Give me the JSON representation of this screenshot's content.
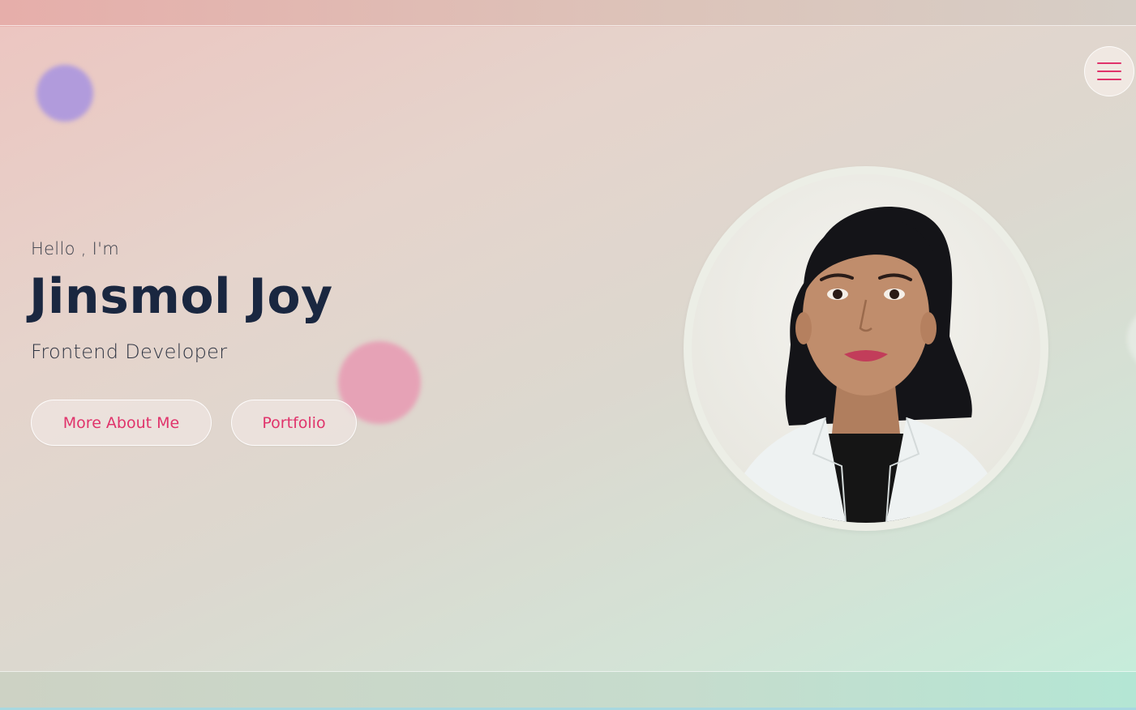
{
  "hero": {
    "greeting": "Hello , I'm",
    "name": "Jinsmol Joy",
    "role": "Frontend Developer",
    "buttons": {
      "about_label": "More About Me",
      "portfolio_label": "Portfolio"
    }
  },
  "nav": {
    "menu_icon": "hamburger-menu-icon"
  },
  "colors": {
    "accent": "#e0336b",
    "heading": "#1a2740",
    "blob_purple": "#b19bdc",
    "blob_pink": "#e6a2b6"
  }
}
